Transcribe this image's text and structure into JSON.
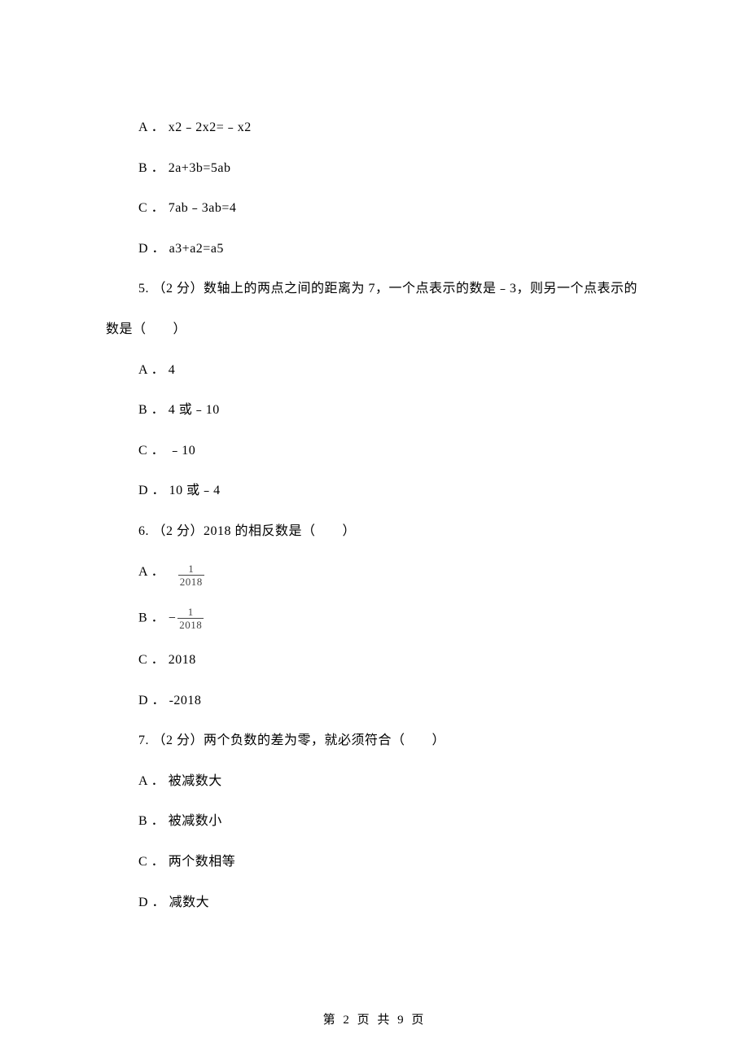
{
  "q4": {
    "optA_label": "A ．",
    "optA_text": "x2﹣2x2=﹣x2",
    "optB_label": "B ．",
    "optB_text": "2a+3b=5ab",
    "optC_label": "C ．",
    "optC_text": "7ab﹣3ab=4",
    "optD_label": "D ．",
    "optD_text": "a3+a2=a5"
  },
  "q5": {
    "stem_line1": "5. （2 分）数轴上的两点之间的距离为 7，一个点表示的数是﹣3，则另一个点表示的",
    "stem_line2": "数是（　　）",
    "optA_label": "A ．",
    "optA_text": "4",
    "optB_label": "B ．",
    "optB_text": "4 或﹣10",
    "optC_label": "C ．",
    "optC_text": "﹣10",
    "optD_label": "D ．",
    "optD_text": "10 或﹣4"
  },
  "q6": {
    "stem": "6. （2 分）2018 的相反数是（　　）",
    "optA_label": "A ．",
    "optA_num": "1",
    "optA_den": "2018",
    "optB_label": "B ．",
    "optB_neg": "−",
    "optB_num": "1",
    "optB_den": "2018",
    "optC_label": "C ．",
    "optC_text": "2018",
    "optD_label": "D ．",
    "optD_text": "-2018"
  },
  "q7": {
    "stem": "7. （2 分）两个负数的差为零，就必须符合（　　）",
    "optA_label": "A ．",
    "optA_text": "被减数大",
    "optB_label": "B ．",
    "optB_text": "被减数小",
    "optC_label": "C ．",
    "optC_text": "两个数相等",
    "optD_label": "D ．",
    "optD_text": "减数大"
  },
  "footer": "第 2 页 共 9 页"
}
